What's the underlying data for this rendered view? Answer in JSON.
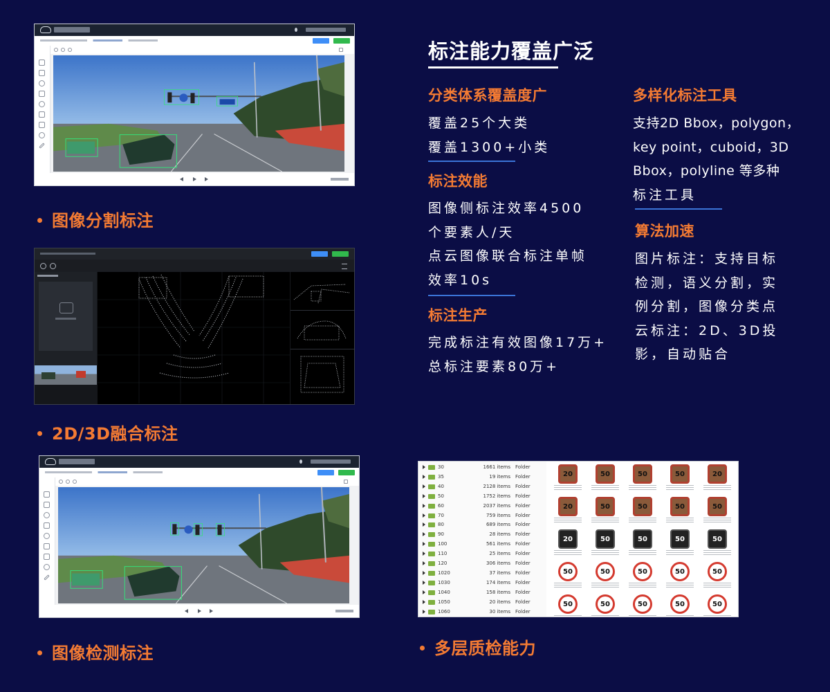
{
  "main": {
    "title": "标注能力覆盖广泛",
    "sections": [
      {
        "heading": "分类体系覆盖度广",
        "lines": [
          "覆盖25个大类",
          "覆盖1300+小类"
        ]
      },
      {
        "heading": "标注效能",
        "lines": [
          "图像侧标注效率4500",
          "个要素人/天",
          "点云图像联合标注单帧",
          "效率10s"
        ]
      },
      {
        "heading": "标注生产",
        "lines": [
          "完成标注有效图像17万+",
          "总标注要素80万+"
        ]
      },
      {
        "heading": "多样化标注工具",
        "lines": [
          "支持2D Bbox，polygon，",
          "key point，cuboid，3D",
          "Bbox，polyline 等多种",
          "标注工具"
        ]
      },
      {
        "heading": "算法加速",
        "lines": [
          "图片标注：支持目标",
          "检测，语义分割，实",
          "例分割，图像分类点",
          "云标注：2D、3D投",
          "影，自动贴合"
        ]
      }
    ]
  },
  "captions": {
    "segmentation": "图像分割标注",
    "fusion": "2D/3D融合标注",
    "detection": "图像检测标注",
    "qc": "多层质检能力"
  },
  "file_list": {
    "rows": [
      {
        "name": "30",
        "count": "1661 items",
        "type": "Folder"
      },
      {
        "name": "35",
        "count": "19 items",
        "type": "Folder"
      },
      {
        "name": "40",
        "count": "2128 items",
        "type": "Folder"
      },
      {
        "name": "50",
        "count": "1752 items",
        "type": "Folder"
      },
      {
        "name": "60",
        "count": "2037 items",
        "type": "Folder"
      },
      {
        "name": "70",
        "count": "759 items",
        "type": "Folder"
      },
      {
        "name": "80",
        "count": "689 items",
        "type": "Folder"
      },
      {
        "name": "90",
        "count": "28 items",
        "type": "Folder"
      },
      {
        "name": "100",
        "count": "561 items",
        "type": "Folder"
      },
      {
        "name": "110",
        "count": "25 items",
        "type": "Folder"
      },
      {
        "name": "120",
        "count": "306 items",
        "type": "Folder"
      },
      {
        "name": "1020",
        "count": "37 items",
        "type": "Folder"
      },
      {
        "name": "1030",
        "count": "174 items",
        "type": "Folder"
      },
      {
        "name": "1040",
        "count": "158 items",
        "type": "Folder"
      },
      {
        "name": "1050",
        "count": "20 items",
        "type": "Folder"
      },
      {
        "name": "1060",
        "count": "30 items",
        "type": "Folder"
      }
    ],
    "sign_grid": [
      [
        "20",
        "50",
        "50",
        "50",
        "20"
      ],
      [
        "20",
        "50",
        "50",
        "50",
        "50"
      ],
      [
        "20",
        "50",
        "50",
        "50",
        "50"
      ],
      [
        "50",
        "50",
        "50",
        "50",
        "50"
      ],
      [
        "50",
        "50",
        "50",
        "50",
        "50"
      ]
    ]
  },
  "colors": {
    "background": "#0b0d45",
    "accent": "#f47b33",
    "separator": "#3b74d8"
  }
}
